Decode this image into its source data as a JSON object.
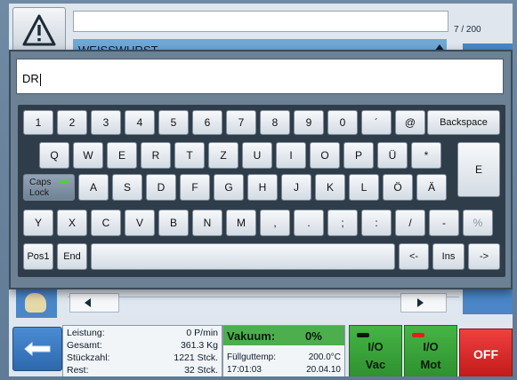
{
  "colors": {
    "accent_blue": "#4a86c8",
    "green": "#3ea63e",
    "red": "#d82424",
    "keyboard_bg": "#2f3d4b"
  },
  "header": {
    "counter": "7 / 200",
    "product_name": "WEISSWURST"
  },
  "keyboard": {
    "input_value": "DR",
    "row1": [
      "1",
      "2",
      "3",
      "4",
      "5",
      "6",
      "7",
      "8",
      "9",
      "0",
      "´",
      "@"
    ],
    "backspace_label": "Backspace",
    "row2": [
      "Q",
      "W",
      "E",
      "R",
      "T",
      "Z",
      "U",
      "I",
      "O",
      "P",
      "Ü",
      "*"
    ],
    "enter_label": "E",
    "caps_label_line1": "Caps",
    "caps_label_line2": "Lock",
    "row3": [
      "A",
      "S",
      "D",
      "F",
      "G",
      "H",
      "J",
      "K",
      "L",
      "Ö",
      "Ä"
    ],
    "row4": [
      "Y",
      "X",
      "C",
      "V",
      "B",
      "N",
      "M",
      ",",
      ".",
      ";",
      ":",
      "/",
      "-",
      "%"
    ],
    "pos1_label": "Pos1",
    "end_label": "End",
    "left_arrow_label": "<-",
    "ins_label": "Ins",
    "right_arrow_label": "->"
  },
  "status": {
    "leistung_label": "Leistung:",
    "leistung_value": "0 P/min",
    "gesamt_label": "Gesamt:",
    "gesamt_value": "361.3 Kg",
    "stueckzahl_label": "Stückzahl:",
    "stueckzahl_value": "1221 Stck.",
    "rest_label": "Rest:",
    "rest_value": "32 Stck.",
    "vakuum_label": "Vakuum:",
    "vakuum_value": "0%",
    "fuellguttemp_label": "Füllguttemp:",
    "fuellguttemp_value": "200.0°C",
    "time": "17:01:03",
    "date": "20.04.10"
  },
  "buttons": {
    "io_vac_line1": "I/O",
    "io_vac_line2": "Vac",
    "io_mot_line1": "I/O",
    "io_mot_line2": "Mot",
    "off_label": "OFF"
  },
  "icons": {
    "warning": "warning-triangle-icon",
    "back": "back-arrow-icon",
    "product_image": "product-image-icon"
  }
}
